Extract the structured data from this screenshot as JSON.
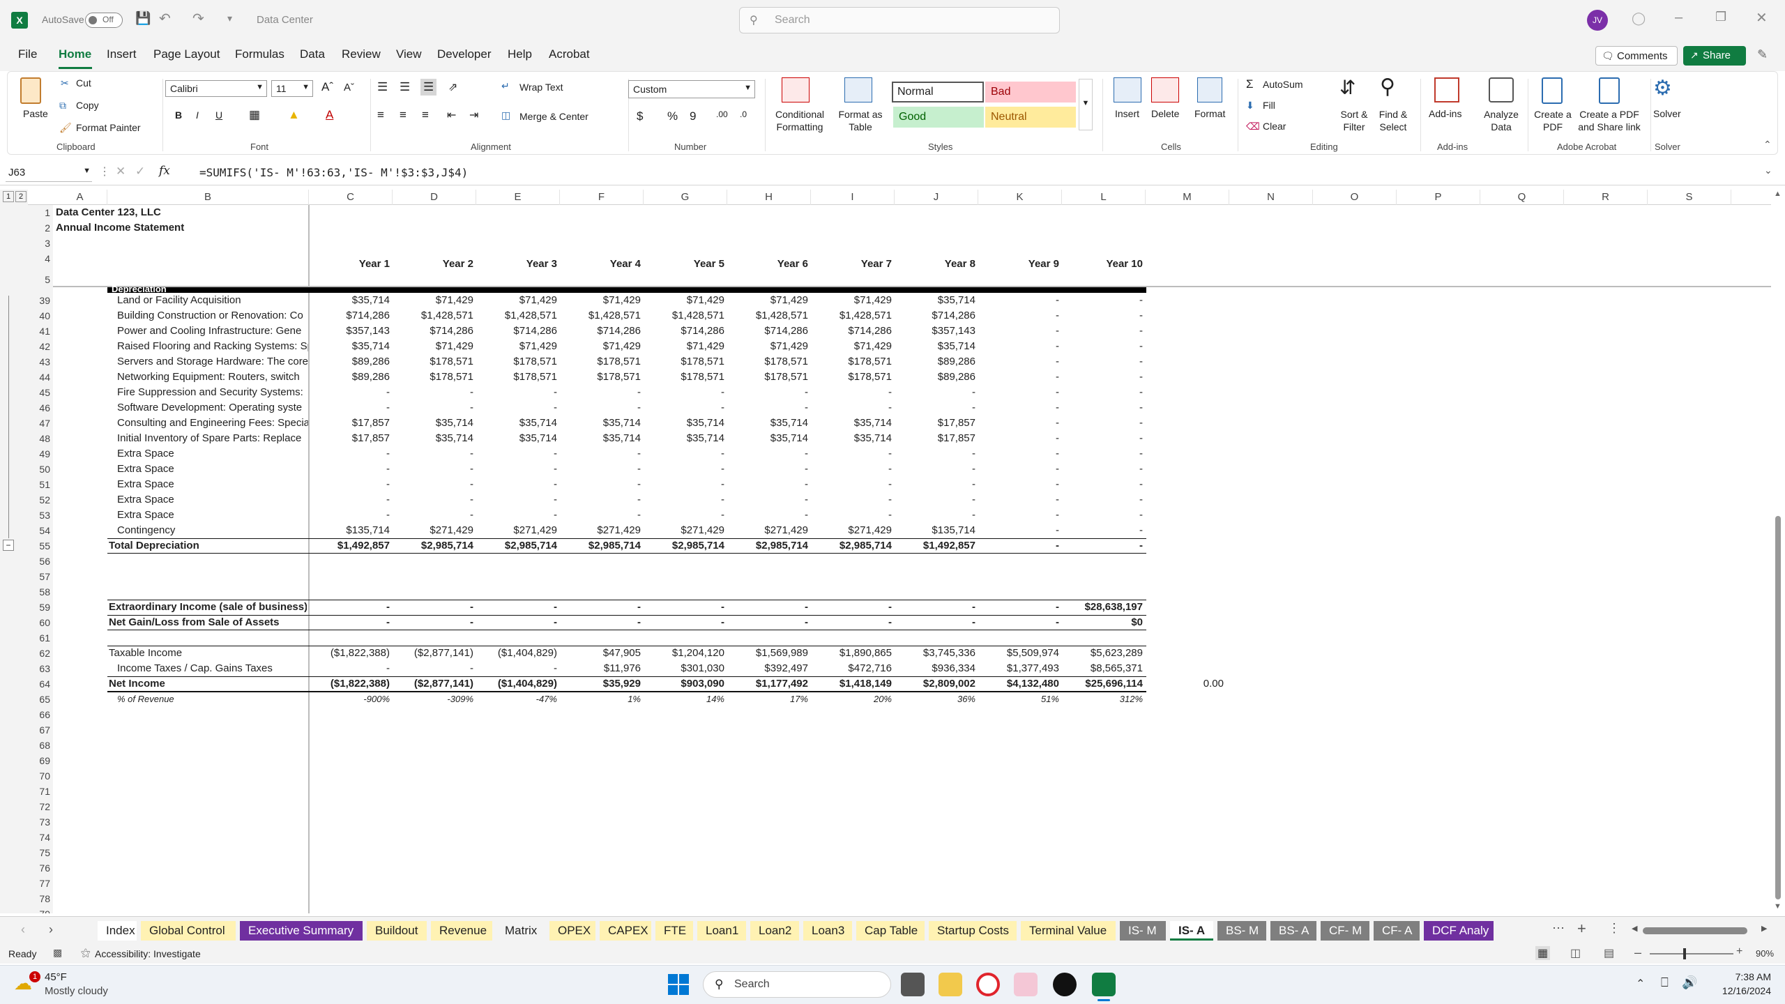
{
  "titlebar": {
    "autosave": "AutoSave",
    "toggle": "Off",
    "doc": "Data Center",
    "search_placeholder": "Search",
    "user": "JV"
  },
  "menu": [
    "File",
    "Home",
    "Insert",
    "Page Layout",
    "Formulas",
    "Data",
    "Review",
    "View",
    "Developer",
    "Help",
    "Acrobat"
  ],
  "menu_right": {
    "comments": "Comments",
    "share": "Share"
  },
  "ribbon": {
    "clipboard": {
      "paste": "Paste",
      "cut": "Cut",
      "copy": "Copy",
      "format_painter": "Format Painter",
      "group": "Clipboard"
    },
    "font": {
      "name": "Calibri",
      "size": "11",
      "group": "Font"
    },
    "alignment": {
      "wrap": "Wrap Text",
      "merge": "Merge & Center",
      "group": "Alignment"
    },
    "number": {
      "format": "Custom",
      "group": "Number"
    },
    "styles": {
      "cond": "Conditional Formatting",
      "fmt_table": "Format as Table",
      "normal": "Normal",
      "bad": "Bad",
      "good": "Good",
      "neutral": "Neutral",
      "group": "Styles"
    },
    "cells": {
      "insert": "Insert",
      "delete": "Delete",
      "format": "Format",
      "group": "Cells"
    },
    "editing": {
      "autosum": "AutoSum",
      "fill": "Fill",
      "clear": "Clear",
      "sort": "Sort & Filter",
      "find": "Find & Select",
      "group": "Editing"
    },
    "addins": {
      "addins": "Add-ins",
      "analyze": "Analyze Data",
      "group": "Add-ins"
    },
    "acrobat": {
      "create": "Create a PDF",
      "share": "Create a PDF and Share link",
      "group": "Adobe Acrobat"
    },
    "solver": {
      "solver": "Solver",
      "group": "Solver"
    }
  },
  "formula_bar": {
    "namebox": "J63",
    "fx": "fx",
    "formula": "=SUMIFS('IS- M'!63:63,'IS- M'!$3:$3,J$4)"
  },
  "columns": [
    "A",
    "B",
    "C",
    "D",
    "E",
    "F",
    "G",
    "H",
    "I",
    "J",
    "K",
    "L",
    "M",
    "N",
    "O",
    "P",
    "Q",
    "R",
    "S"
  ],
  "top_rows": [
    {
      "r": "1",
      "a": "Data Center 123, LLC"
    },
    {
      "r": "2",
      "a": "Annual Income Statement"
    },
    {
      "r": "3"
    },
    {
      "r": "4",
      "years": [
        "Year 1",
        "Year 2",
        "Year 3",
        "Year 4",
        "Year 5",
        "Year 6",
        "Year 7",
        "Year 8",
        "Year 9",
        "Year 10"
      ]
    },
    {
      "r": "5"
    }
  ],
  "section_label": "Depreciation",
  "rows": [
    {
      "r": "39",
      "b": "Land or Facility Acquisition",
      "v": [
        "$35,714",
        "$71,429",
        "$71,429",
        "$71,429",
        "$71,429",
        "$71,429",
        "$71,429",
        "$35,714",
        "-",
        "-"
      ]
    },
    {
      "r": "40",
      "b": "Building Construction or Renovation: Co",
      "v": [
        "$714,286",
        "$1,428,571",
        "$1,428,571",
        "$1,428,571",
        "$1,428,571",
        "$1,428,571",
        "$1,428,571",
        "$714,286",
        "-",
        "-"
      ]
    },
    {
      "r": "41",
      "b": "Power and Cooling Infrastructure: Gene",
      "v": [
        "$357,143",
        "$714,286",
        "$714,286",
        "$714,286",
        "$714,286",
        "$714,286",
        "$714,286",
        "$357,143",
        "-",
        "-"
      ]
    },
    {
      "r": "42",
      "b": "Raised Flooring and Racking Systems: Sp",
      "v": [
        "$35,714",
        "$71,429",
        "$71,429",
        "$71,429",
        "$71,429",
        "$71,429",
        "$71,429",
        "$35,714",
        "-",
        "-"
      ]
    },
    {
      "r": "43",
      "b": "Servers and Storage Hardware: The core",
      "v": [
        "$89,286",
        "$178,571",
        "$178,571",
        "$178,571",
        "$178,571",
        "$178,571",
        "$178,571",
        "$89,286",
        "-",
        "-"
      ]
    },
    {
      "r": "44",
      "b": "Networking Equipment: Routers, switch",
      "v": [
        "$89,286",
        "$178,571",
        "$178,571",
        "$178,571",
        "$178,571",
        "$178,571",
        "$178,571",
        "$89,286",
        "-",
        "-"
      ]
    },
    {
      "r": "45",
      "b": "Fire Suppression and Security Systems:",
      "v": [
        "-",
        "-",
        "-",
        "-",
        "-",
        "-",
        "-",
        "-",
        "-",
        "-"
      ]
    },
    {
      "r": "46",
      "b": "Software Development: Operating syste",
      "v": [
        "-",
        "-",
        "-",
        "-",
        "-",
        "-",
        "-",
        "-",
        "-",
        "-"
      ]
    },
    {
      "r": "47",
      "b": "Consulting and Engineering Fees: Specia",
      "v": [
        "$17,857",
        "$35,714",
        "$35,714",
        "$35,714",
        "$35,714",
        "$35,714",
        "$35,714",
        "$17,857",
        "-",
        "-"
      ]
    },
    {
      "r": "48",
      "b": "Initial Inventory of Spare Parts: Replace",
      "v": [
        "$17,857",
        "$35,714",
        "$35,714",
        "$35,714",
        "$35,714",
        "$35,714",
        "$35,714",
        "$17,857",
        "-",
        "-"
      ]
    },
    {
      "r": "49",
      "b": "Extra Space",
      "v": [
        "-",
        "-",
        "-",
        "-",
        "-",
        "-",
        "-",
        "-",
        "-",
        "-"
      ]
    },
    {
      "r": "50",
      "b": "Extra Space",
      "v": [
        "-",
        "-",
        "-",
        "-",
        "-",
        "-",
        "-",
        "-",
        "-",
        "-"
      ]
    },
    {
      "r": "51",
      "b": "Extra Space",
      "v": [
        "-",
        "-",
        "-",
        "-",
        "-",
        "-",
        "-",
        "-",
        "-",
        "-"
      ]
    },
    {
      "r": "52",
      "b": "Extra Space",
      "v": [
        "-",
        "-",
        "-",
        "-",
        "-",
        "-",
        "-",
        "-",
        "-",
        "-"
      ]
    },
    {
      "r": "53",
      "b": "Extra Space",
      "v": [
        "-",
        "-",
        "-",
        "-",
        "-",
        "-",
        "-",
        "-",
        "-",
        "-"
      ]
    },
    {
      "r": "54",
      "b": "Contingency",
      "v": [
        "$135,714",
        "$271,429",
        "$271,429",
        "$271,429",
        "$271,429",
        "$271,429",
        "$271,429",
        "$135,714",
        "-",
        "-"
      ]
    },
    {
      "r": "55",
      "a": "Total Depreciation",
      "bold": true,
      "v": [
        "$1,492,857",
        "$2,985,714",
        "$2,985,714",
        "$2,985,714",
        "$2,985,714",
        "$2,985,714",
        "$2,985,714",
        "$1,492,857",
        "-",
        "-"
      ]
    },
    {
      "r": "56"
    },
    {
      "r": "57"
    },
    {
      "r": "58"
    },
    {
      "r": "59",
      "a": "Extraordinary Income (sale of business)",
      "bold": true,
      "v": [
        "-",
        "-",
        "-",
        "-",
        "-",
        "-",
        "-",
        "-",
        "-",
        "$28,638,197"
      ]
    },
    {
      "r": "60",
      "a": "Net Gain/Loss from Sale of Assets",
      "bold": true,
      "v": [
        "-",
        "-",
        "-",
        "-",
        "-",
        "-",
        "-",
        "-",
        "-",
        "$0"
      ]
    },
    {
      "r": "61"
    },
    {
      "r": "62",
      "a": "Taxable Income",
      "v": [
        "($1,822,388)",
        "($2,877,141)",
        "($1,404,829)",
        "$47,905",
        "$1,204,120",
        "$1,569,989",
        "$1,890,865",
        "$3,745,336",
        "$5,509,974",
        "$5,623,289"
      ]
    },
    {
      "r": "63",
      "b": "Income Taxes / Cap. Gains Taxes",
      "v": [
        "-",
        "-",
        "-",
        "$11,976",
        "$301,030",
        "$392,497",
        "$472,716",
        "$936,334",
        "$1,377,493",
        "$8,565,371"
      ]
    },
    {
      "r": "64",
      "a": "Net Income",
      "bold": true,
      "v": [
        "($1,822,388)",
        "($2,877,141)",
        "($1,404,829)",
        "$35,929",
        "$903,090",
        "$1,177,492",
        "$1,418,149",
        "$2,809,002",
        "$4,132,480",
        "$25,696,114"
      ],
      "m": "0.00"
    },
    {
      "r": "65",
      "b": "% of Revenue",
      "ital": true,
      "v": [
        "-900%",
        "-309%",
        "-47%",
        "1%",
        "14%",
        "17%",
        "20%",
        "36%",
        "51%",
        "312%"
      ]
    },
    {
      "r": "66"
    },
    {
      "r": "67"
    },
    {
      "r": "68"
    },
    {
      "r": "69"
    },
    {
      "r": "70"
    },
    {
      "r": "71"
    },
    {
      "r": "72"
    },
    {
      "r": "73"
    },
    {
      "r": "74"
    },
    {
      "r": "75"
    },
    {
      "r": "76"
    },
    {
      "r": "77"
    },
    {
      "r": "78"
    },
    {
      "r": "79"
    }
  ],
  "tabs": [
    {
      "label": "Index",
      "bg": "#ffffff",
      "fg": "#222"
    },
    {
      "label": "Global Control",
      "bg": "#fff2b3",
      "fg": "#222"
    },
    {
      "label": "Executive Summary",
      "bg": "#7030a0",
      "fg": "#ffffff"
    },
    {
      "label": "Buildout",
      "bg": "#fff2b3",
      "fg": "#222"
    },
    {
      "label": "Revenue",
      "bg": "#fff2b3",
      "fg": "#222"
    },
    {
      "label": "Matrix",
      "bg": "#f3f3f3",
      "fg": "#222"
    },
    {
      "label": "OPEX",
      "bg": "#fff2b3",
      "fg": "#222"
    },
    {
      "label": "CAPEX",
      "bg": "#fff2b3",
      "fg": "#222"
    },
    {
      "label": "FTE",
      "bg": "#fff2b3",
      "fg": "#222"
    },
    {
      "label": "Loan1",
      "bg": "#fff2b3",
      "fg": "#222"
    },
    {
      "label": "Loan2",
      "bg": "#fff2b3",
      "fg": "#222"
    },
    {
      "label": "Loan3",
      "bg": "#fff2b3",
      "fg": "#222"
    },
    {
      "label": "Cap Table",
      "bg": "#fff2b3",
      "fg": "#222"
    },
    {
      "label": "Startup Costs",
      "bg": "#fff2b3",
      "fg": "#222"
    },
    {
      "label": "Terminal Value",
      "bg": "#fff2b3",
      "fg": "#222"
    },
    {
      "label": "IS- M",
      "bg": "#7f7f7f",
      "fg": "#ffffff"
    },
    {
      "label": "IS- A",
      "bg": "#ffffff",
      "fg": "#222",
      "active": true
    },
    {
      "label": "BS- M",
      "bg": "#7f7f7f",
      "fg": "#ffffff"
    },
    {
      "label": "BS- A",
      "bg": "#7f7f7f",
      "fg": "#ffffff"
    },
    {
      "label": "CF- M",
      "bg": "#7f7f7f",
      "fg": "#ffffff"
    },
    {
      "label": "CF- A",
      "bg": "#7f7f7f",
      "fg": "#ffffff"
    },
    {
      "label": "DCF Analy",
      "bg": "#7030a0",
      "fg": "#ffffff"
    }
  ],
  "status": {
    "ready": "Ready",
    "accessibility": "Accessibility: Investigate",
    "zoom": "90%"
  },
  "taskbar": {
    "temp": "45°F",
    "weather": "Mostly cloudy",
    "search": "Search",
    "time": "7:38 AM",
    "date": "12/16/2024",
    "badge": "1"
  }
}
